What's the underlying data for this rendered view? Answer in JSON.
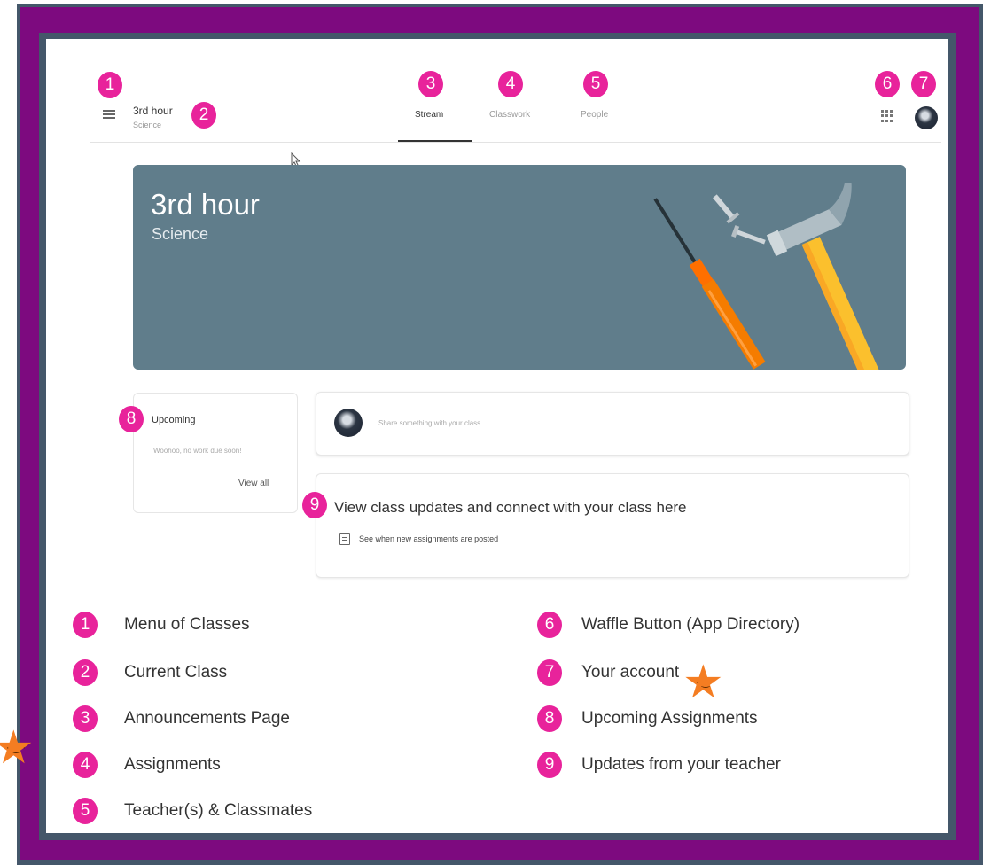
{
  "header": {
    "class_name": "3rd hour",
    "class_subject": "Science",
    "tabs": [
      "Stream",
      "Classwork",
      "People"
    ]
  },
  "banner": {
    "title": "3rd hour",
    "subtitle": "Science"
  },
  "upcoming": {
    "title": "Upcoming",
    "text": "Woohoo, no work due soon!",
    "view_all": "View all"
  },
  "share": {
    "placeholder": "Share something with your class..."
  },
  "updates": {
    "title": "View class updates and connect with your class here",
    "subtitle": "See when new assignments are posted"
  },
  "callouts": [
    "1",
    "2",
    "3",
    "4",
    "5",
    "6",
    "7",
    "8",
    "9"
  ],
  "legend": [
    {
      "num": "1",
      "label": "Menu of Classes"
    },
    {
      "num": "2",
      "label": "Current Class"
    },
    {
      "num": "3",
      "label": "Announcements Page"
    },
    {
      "num": "4",
      "label": "Assignments"
    },
    {
      "num": "5",
      "label": "Teacher(s) & Classmates"
    },
    {
      "num": "6",
      "label": "Waffle Button (App Directory)"
    },
    {
      "num": "7",
      "label": "Your account"
    },
    {
      "num": "8",
      "label": "Upcoming Assignments"
    },
    {
      "num": "9",
      "label": "Updates from your teacher"
    }
  ],
  "colors": {
    "frame": "#7d0a7f",
    "frame_border": "#44576a",
    "callout": "#e8239b",
    "banner": "#607d8b",
    "star": "#f47d22"
  }
}
